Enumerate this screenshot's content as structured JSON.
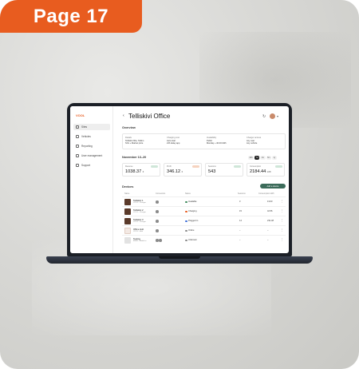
{
  "badge": {
    "label": "Page 17"
  },
  "app": {
    "logo": "VOOL",
    "title": "Telliskivi Office",
    "nav": [
      {
        "label": "Sites"
      },
      {
        "label": "Vehicles"
      },
      {
        "label": "Reporting"
      },
      {
        "label": "User management"
      },
      {
        "label": "Support"
      }
    ]
  },
  "overview": {
    "heading": "Overview",
    "cols": [
      {
        "label": "Details",
        "line1": "Telliskivi 60a, Tallinn",
        "line2": "SOL + Market price"
      },
      {
        "label": "Charging cost",
        "line1": "Auto start",
        "line2": "24h delay app"
      },
      {
        "label": "Availability",
        "line1": "Public",
        "line2": "Monday + 40.00 kWh"
      },
      {
        "label": "Charger access",
        "line1": "Any user",
        "line2": "Any vehicle"
      }
    ]
  },
  "period": {
    "heading": "November 13–20",
    "ranges": [
      "24h",
      "7d",
      "1m",
      "6m",
      "1y"
    ],
    "selected": "7d"
  },
  "stats": [
    {
      "label": "Revenue",
      "value": "1038.37",
      "unit": "€",
      "badge_color": "#cfe6d8"
    },
    {
      "label": "Profit",
      "value": "346.12",
      "unit": "€",
      "badge_color": "#f6d3bf"
    },
    {
      "label": "Sessions",
      "value": "543",
      "unit": "",
      "badge_color": "#cfe6d8"
    },
    {
      "label": "Consumption",
      "value": "2184.44",
      "unit": "kWh",
      "badge_color": "#cfe6d8"
    }
  ],
  "devices": {
    "heading": "Devices",
    "add_label": "Add a device",
    "columns": [
      "Name",
      "Connectors",
      "Status",
      "Sessions",
      "Consumption kWh"
    ],
    "rows": [
      {
        "name": "Telliskivi 1",
        "sub": "VOOL • Charger",
        "status": "Available",
        "status_color": "#3c8a5a",
        "sessions": "3",
        "consumption": "13.03",
        "thumb": "dark",
        "connectors": 1
      },
      {
        "name": "Telliskivi 2",
        "sub": "VOOL • Charger",
        "status": "Charging",
        "status_color": "#e85c1f",
        "sessions": "15",
        "consumption": "42.56",
        "thumb": "dark",
        "connectors": 1
      },
      {
        "name": "Telliskivi 3",
        "sub": "VOOL • Charger",
        "status": "Plugged in",
        "status_color": "#3f6fd8",
        "sessions": "14",
        "consumption": "231.48",
        "thumb": "dark",
        "connectors": 1
      },
      {
        "name": "Office Hub",
        "sub": "VOOL • Hub",
        "status": "Online",
        "status_color": "#8a8a8a",
        "sessions": "–",
        "consumption": "–",
        "thumb": "light",
        "connectors": 1
      },
      {
        "name": "Testing",
        "sub": "ENSE • Model m",
        "status": "Unknown",
        "status_color": "#8a8a8a",
        "sessions": "–",
        "consumption": "–",
        "thumb": "gray",
        "connectors": 2
      }
    ]
  }
}
